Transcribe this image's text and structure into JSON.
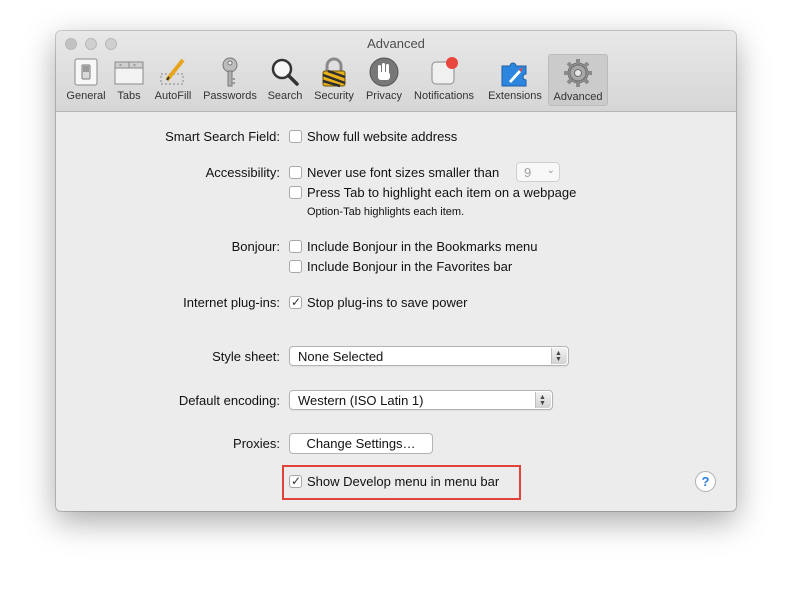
{
  "window": {
    "title": "Advanced"
  },
  "toolbar": {
    "items": [
      {
        "label": "General",
        "icon": "switch-icon"
      },
      {
        "label": "Tabs",
        "icon": "tabs-icon"
      },
      {
        "label": "AutoFill",
        "icon": "pencil-icon"
      },
      {
        "label": "Passwords",
        "icon": "key-icon"
      },
      {
        "label": "Search",
        "icon": "magnifier-icon"
      },
      {
        "label": "Security",
        "icon": "padlock-icon"
      },
      {
        "label": "Privacy",
        "icon": "hand-icon"
      },
      {
        "label": "Notifications",
        "icon": "notification-badge-icon"
      },
      {
        "label": "Extensions",
        "icon": "puzzle-icon"
      },
      {
        "label": "Advanced",
        "icon": "gear-icon"
      }
    ],
    "selected": "Advanced"
  },
  "settings": {
    "smart_search": {
      "label": "Smart Search Field:",
      "option": "Show full website address",
      "checked": false
    },
    "accessibility": {
      "label": "Accessibility:",
      "option1": "Never use font sizes smaller than",
      "font_size": "9",
      "option2": "Press Tab to highlight each item on a webpage",
      "hint": "Option-Tab highlights each item."
    },
    "bonjour": {
      "label": "Bonjour:",
      "option1": "Include Bonjour in the Bookmarks menu",
      "option2": "Include Bonjour in the Favorites bar"
    },
    "plugins": {
      "label": "Internet plug-ins:",
      "option": "Stop plug-ins to save power",
      "checked": true
    },
    "style_sheet": {
      "label": "Style sheet:",
      "value": "None Selected"
    },
    "encoding": {
      "label": "Default encoding:",
      "value": "Western (ISO Latin 1)"
    },
    "proxies": {
      "label": "Proxies:",
      "button": "Change Settings…"
    },
    "develop": {
      "option": "Show Develop menu in menu bar",
      "checked": true
    },
    "help": "?"
  },
  "colors": {
    "highlight": "#e0433a",
    "accent": "#2d6ef0"
  }
}
